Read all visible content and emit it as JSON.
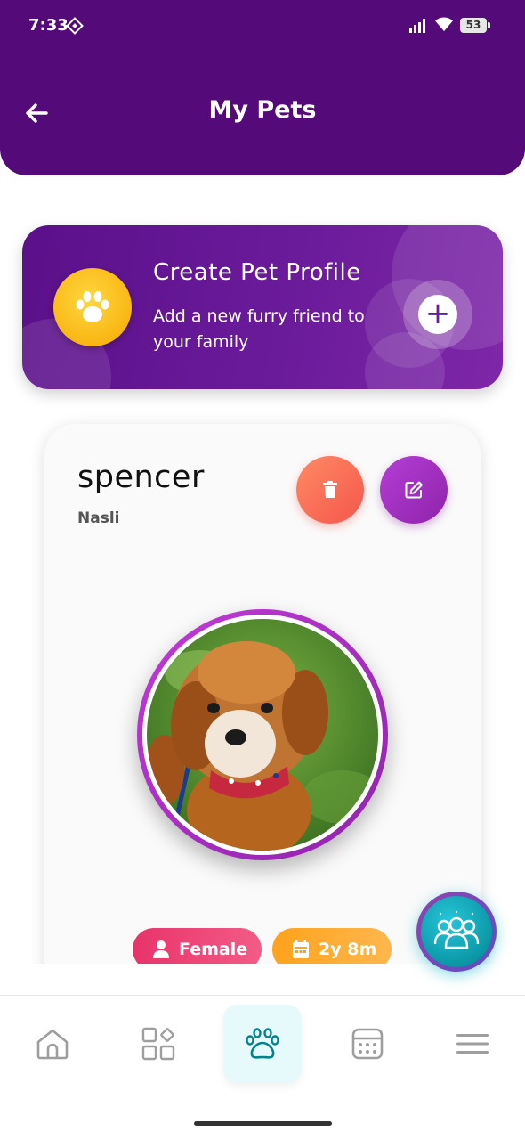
{
  "status_bar": {
    "time": "7:33",
    "battery": "53"
  },
  "header": {
    "title": "My Pets"
  },
  "create_profile": {
    "title": "Create Pet Profile",
    "subtitle": "Add a new furry friend to your family"
  },
  "pet": {
    "name": "spencer",
    "breed": "Nasli",
    "gender": "Female",
    "age": "2y 8m"
  },
  "bottom_nav": {
    "items": [
      "home-icon",
      "services-icon",
      "paw-icon",
      "calendar-icon",
      "menu-icon"
    ],
    "active_index": 2
  },
  "colors": {
    "header": "#550a7a",
    "accent_purple": "#8e24aa",
    "paw_yellow": "#ffc107",
    "delete": "#f4564a",
    "gender_chip": "#e8336a",
    "age_chip": "#ffa21c",
    "active_nav": "#00838f"
  }
}
